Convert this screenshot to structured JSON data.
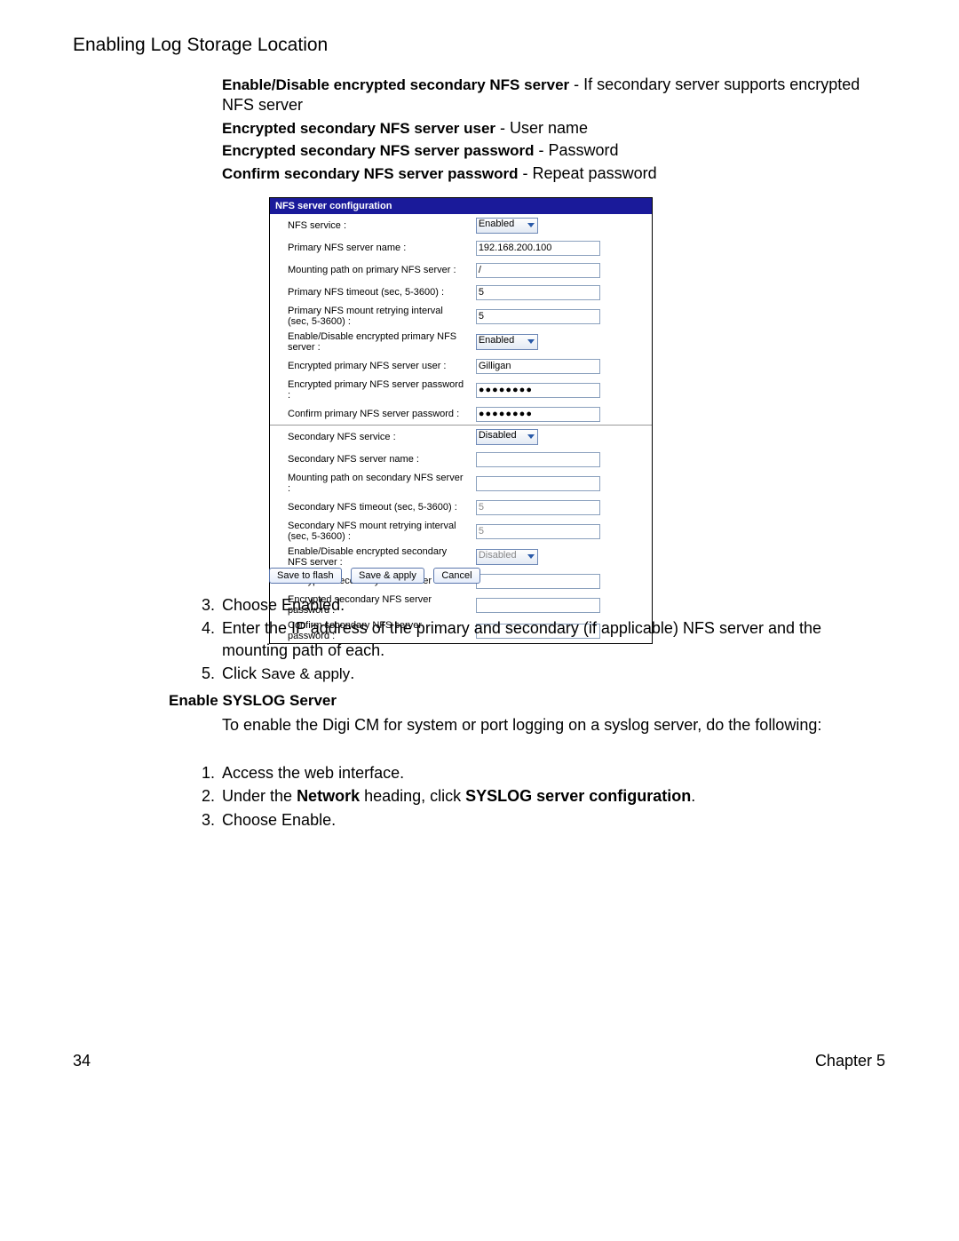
{
  "page": {
    "section_title": "Enabling Log Storage Location",
    "number": "34",
    "chapter": "Chapter 5"
  },
  "intro": [
    {
      "bold": "Enable/Disable encrypted secondary NFS server",
      "sep": " - ",
      "text": "If secondary server supports encrypted NFS server"
    },
    {
      "bold": "Encrypted secondary NFS server user",
      "sep": " - ",
      "text": "User name"
    },
    {
      "bold": "Encrypted secondary NFS server password",
      "sep": " - ",
      "text": "Password"
    },
    {
      "bold": "Confirm secondary NFS server password",
      "sep": " - ",
      "text": "Repeat password"
    }
  ],
  "panel": {
    "title": "NFS server configuration",
    "rows": [
      {
        "label": "NFS service :",
        "type": "select",
        "value": "Enabled",
        "active": true
      },
      {
        "label": "Primary NFS server name :",
        "type": "text",
        "value": "192.168.200.100",
        "active": true
      },
      {
        "label": "Mounting path on primary NFS server :",
        "type": "text",
        "value": "/",
        "active": true
      },
      {
        "label": "Primary NFS timeout (sec, 5-3600) :",
        "type": "text",
        "value": "5",
        "active": true
      },
      {
        "label": "Primary NFS mount retrying interval (sec, 5-3600) :",
        "type": "text",
        "value": "5",
        "active": true
      },
      {
        "label": "Enable/Disable encrypted primary NFS server :",
        "type": "select",
        "value": "Enabled",
        "active": true
      },
      {
        "label": "Encrypted primary NFS server user :",
        "type": "text",
        "value": "Gilligan",
        "active": true
      },
      {
        "label": "Encrypted primary NFS server password :",
        "type": "password",
        "value": "●●●●●●●●",
        "active": true
      },
      {
        "label": "Confirm primary NFS server password :",
        "type": "password",
        "value": "●●●●●●●●",
        "active": true
      },
      {
        "label": "Secondary NFS service :",
        "type": "select",
        "value": "Disabled",
        "active": true,
        "sep_before": true
      },
      {
        "label": "Secondary NFS server name :",
        "type": "text",
        "value": "",
        "active": false
      },
      {
        "label": "Mounting path on secondary NFS server :",
        "type": "text",
        "value": "",
        "active": false
      },
      {
        "label": "Secondary NFS timeout (sec, 5-3600) :",
        "type": "text",
        "value": "5",
        "active": false
      },
      {
        "label": "Secondary NFS mount retrying interval (sec, 5-3600) :",
        "type": "text",
        "value": "5",
        "active": false
      },
      {
        "label": "Enable/Disable encrypted secondary NFS server :",
        "type": "select",
        "value": "Disabled",
        "active": false
      },
      {
        "label": "Encrypted secondary NFS server user :",
        "type": "text",
        "value": "",
        "active": false
      },
      {
        "label": "Encrypted secondary NFS server password :",
        "type": "password",
        "value": "",
        "active": false
      },
      {
        "label": "Confirm secondary NFS server password :",
        "type": "password",
        "value": "",
        "active": false
      }
    ]
  },
  "buttons": {
    "save_flash": "Save to flash",
    "save_apply": "Save & apply",
    "cancel": "Cancel"
  },
  "steps_a": [
    {
      "n": "3.",
      "t": "Choose Enabled."
    },
    {
      "n": "4.",
      "t": "Enter the IP address of the primary and secondary (if applicable) NFS server and the mounting path of each."
    },
    {
      "n": "5.",
      "pre": "Click ",
      "code": "Save & apply",
      "post": "."
    }
  ],
  "syslog": {
    "heading": "Enable SYSLOG Server",
    "body": "To enable the Digi CM for system or port logging on a syslog server, do the following:",
    "steps": [
      {
        "n": "1.",
        "t": "Access the web interface."
      },
      {
        "n": "2.",
        "pre": "Under the ",
        "b1": "Network",
        "mid": " heading, click ",
        "b2": "SYSLOG server configuration",
        "post": "."
      },
      {
        "n": "3.",
        "t": "Choose Enable."
      }
    ]
  }
}
